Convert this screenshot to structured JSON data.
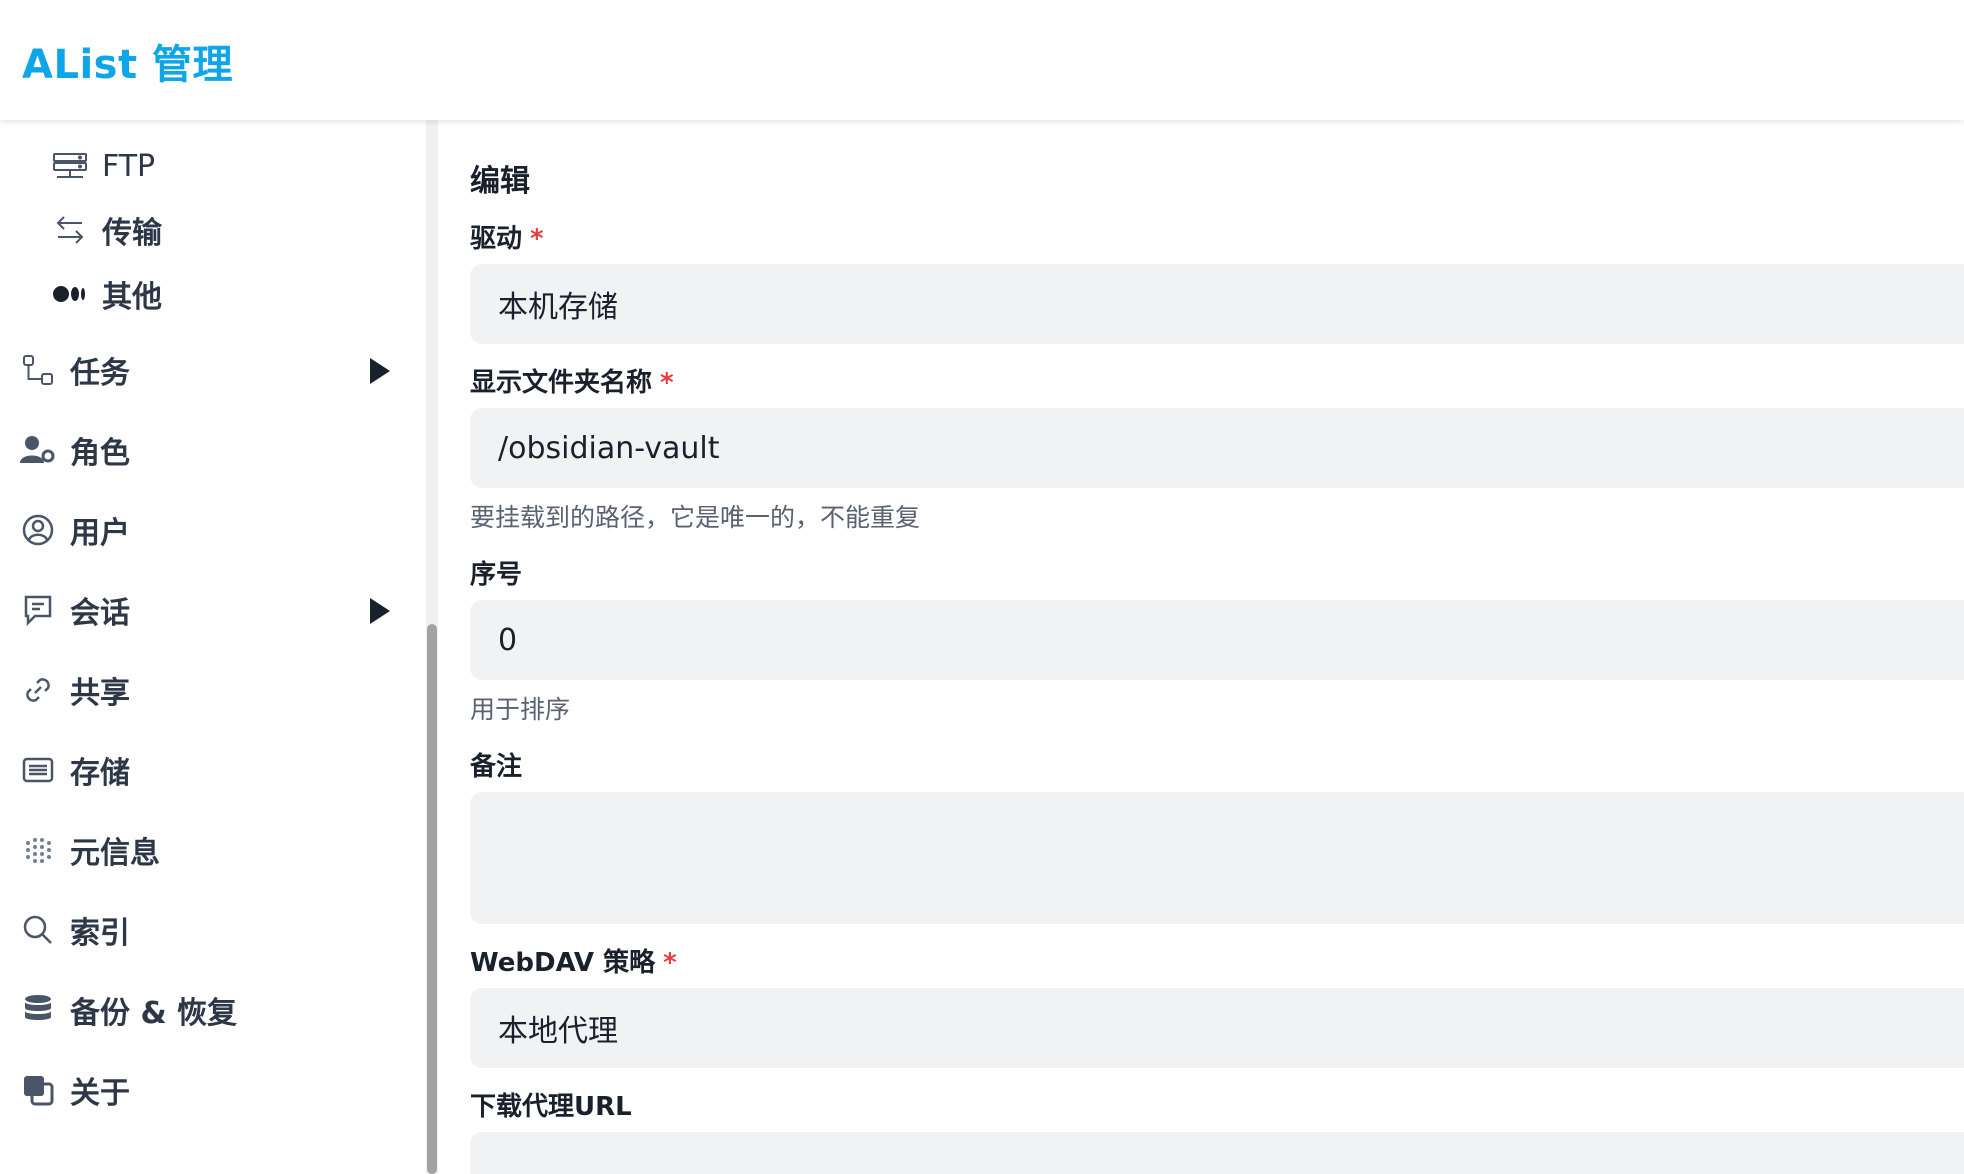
{
  "app": {
    "title": "AList 管理"
  },
  "sidebar": {
    "sub_items": [
      {
        "label": "FTP",
        "icon": "server-icon"
      },
      {
        "label": "传输",
        "icon": "transfer-arrows-icon"
      },
      {
        "label": "其他",
        "icon": "dots-icon"
      }
    ],
    "items": [
      {
        "label": "任务",
        "icon": "workflow-icon",
        "expandable": true
      },
      {
        "label": "角色",
        "icon": "user-gear-icon",
        "expandable": false
      },
      {
        "label": "用户",
        "icon": "user-circle-icon",
        "expandable": false
      },
      {
        "label": "会话",
        "icon": "chat-icon",
        "expandable": true
      },
      {
        "label": "共享",
        "icon": "link-icon",
        "expandable": false
      },
      {
        "label": "存储",
        "icon": "storage-list-icon",
        "expandable": false
      },
      {
        "label": "元信息",
        "icon": "meta-dots-icon",
        "expandable": false
      },
      {
        "label": "索引",
        "icon": "search-icon",
        "expandable": false
      },
      {
        "label": "备份 & 恢复",
        "icon": "database-icon",
        "expandable": false
      },
      {
        "label": "关于",
        "icon": "about-squares-icon",
        "expandable": false
      }
    ]
  },
  "form": {
    "title": "编辑",
    "driver": {
      "label": "驱动",
      "required": "*",
      "value": "本机存储"
    },
    "mount_path": {
      "label": "显示文件夹名称",
      "required": "*",
      "value": "/obsidian-vault",
      "help": "要挂载到的路径，它是唯一的，不能重复"
    },
    "order": {
      "label": "序号",
      "value": "0",
      "help": "用于排序"
    },
    "remark": {
      "label": "备注",
      "value": ""
    },
    "webdav_policy": {
      "label": "WebDAV 策略",
      "required": "*",
      "value": "本地代理"
    },
    "down_proxy_url": {
      "label": "下载代理URL",
      "value": ""
    }
  },
  "colors": {
    "brand": "#0ea5e9",
    "required": "#e53e3e",
    "input_bg": "#f1f2f4"
  }
}
